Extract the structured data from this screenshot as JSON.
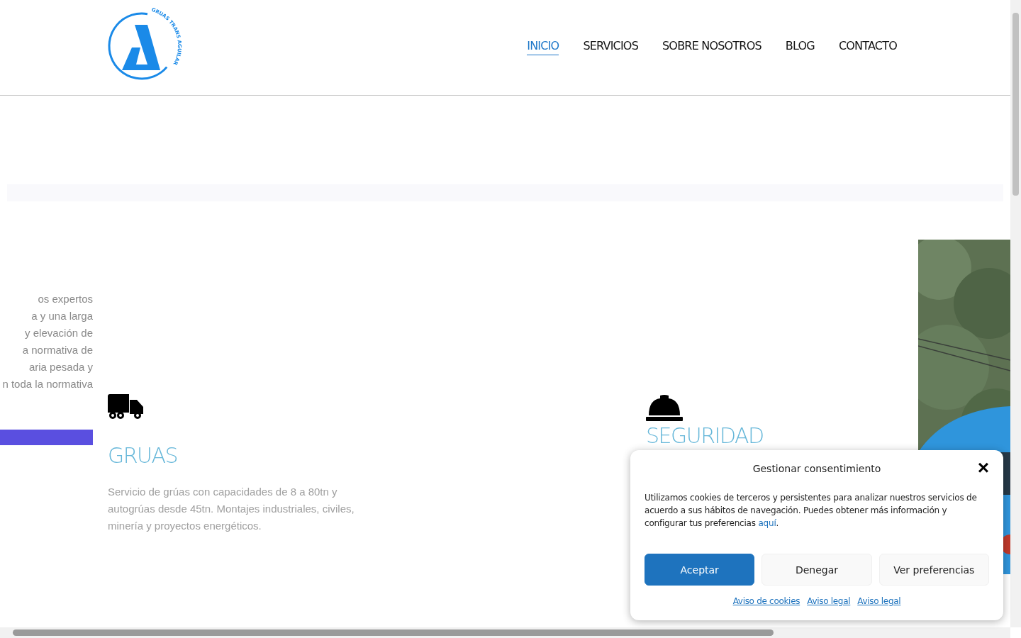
{
  "logo": {
    "text": "GRUAS TRANS AGUILAR"
  },
  "nav": [
    {
      "label": "INICIO",
      "selected": true
    },
    {
      "label": "SERVICIOS",
      "selected": false
    },
    {
      "label": "SOBRE NOSOTROS",
      "selected": false
    },
    {
      "label": "BLOG",
      "selected": false
    },
    {
      "label": "CONTACTO",
      "selected": false
    }
  ],
  "intro_lines": [
    "os expertos",
    "a y una larga",
    "y elevación de",
    "a normativa de",
    "aria pesada y",
    "n toda la normativa"
  ],
  "services": [
    {
      "kind": "truck",
      "title": "GRUAS",
      "text": "Servicio de grúas con capacidades de 8 a 80tn y autogrúas desde 45tn. Montajes industriales, civiles, minería y proyectos energéticos."
    },
    {
      "kind": "helmet",
      "title": "SEGURIDAD"
    }
  ],
  "consent": {
    "title": "Gestionar consentimiento",
    "close": "×",
    "text": "Utilizamos cookies de terceros y persistentes para analizar nuestros servicios de acuerdo a sus hábitos de navegación. Puedes obtener más información y configurar tus preferencias ",
    "link": "aquí",
    "after_link": ".",
    "buttons": [
      {
        "label": "Aceptar",
        "kind": "primary"
      },
      {
        "label": "Denegar",
        "kind": "secondary"
      },
      {
        "label": "Ver preferencias",
        "kind": "secondary"
      }
    ],
    "links": [
      "Aviso de cookies",
      "Aviso legal",
      "Aviso legal"
    ]
  }
}
